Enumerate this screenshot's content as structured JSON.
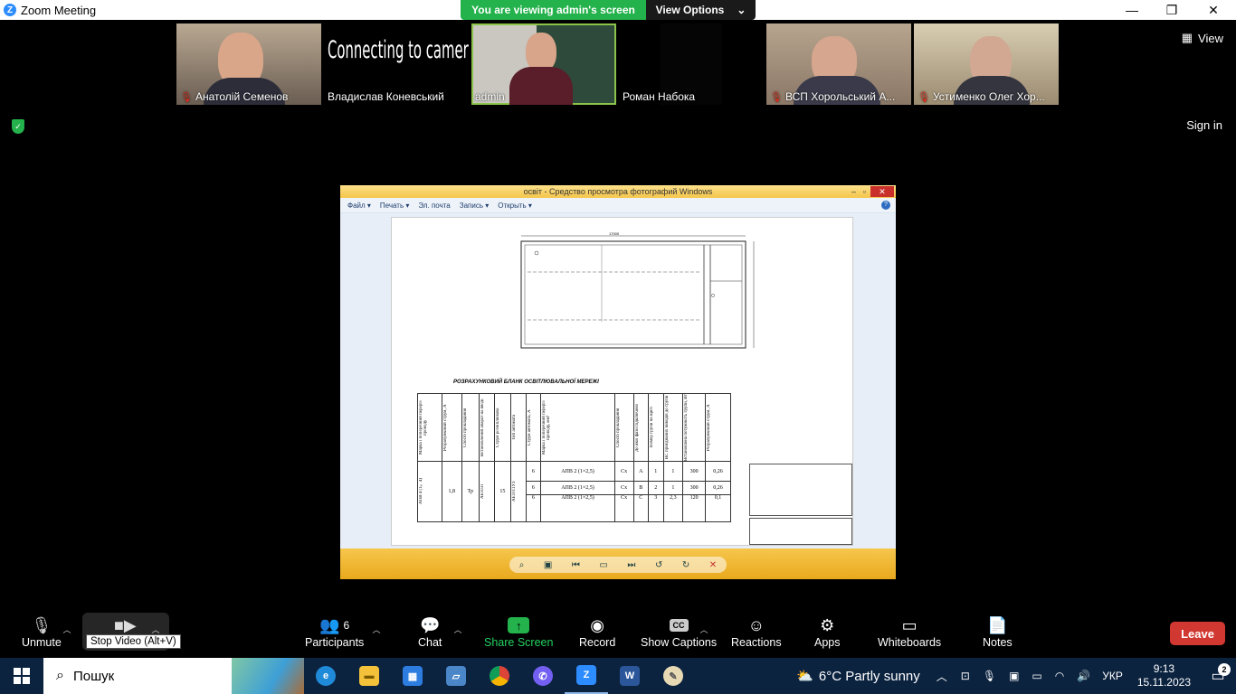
{
  "window": {
    "title": "Zoom Meeting",
    "minimize": "—",
    "restore": "❐",
    "close": "✕"
  },
  "share_banner": {
    "viewing": "You are viewing admin's screen",
    "view_options": "View Options"
  },
  "participants": [
    {
      "name": "Анатолій Семенов",
      "muted": true
    },
    {
      "name": "Владислав Коневський",
      "muted": false,
      "status": "Connecting to camera..."
    },
    {
      "name": "admin",
      "muted": false,
      "active": true
    },
    {
      "name": "Роман Набока",
      "muted": false
    },
    {
      "name": "ВСП Хорольський А...",
      "muted": true
    },
    {
      "name": "Устименко Олег Хор...",
      "muted": true
    }
  ],
  "view_button": "View",
  "sign_in": "Sign in",
  "viewer": {
    "title": "освіт - Средство просмотра фотографий Windows",
    "menu": [
      "Файл ▾",
      "Печать ▾",
      "Эл. почта",
      "Запись ▾",
      "Открыть ▾"
    ],
    "drawing_caption": "РОЗРАХУНКОВИЙ БЛАНК ОСВІТЛЮВАЛЬНОЇ МЕРЕЖІ",
    "drawing_dimension": "17000",
    "table_headers": [
      "Марка і поперечний переріз проводу",
      "Розрахунковий струм, А",
      "Спосіб прокладання",
      "Встановлений апарат на вводі",
      "Струм розчіплювача",
      "Тип автомата",
      "Струм автомата, А",
      "Марка і поперечний переріз проводу, мм²",
      "Спосіб прокладання",
      "До якої фази підключено",
      "Номер групи на щиті",
      "Вс. приєднаних виводів до групи",
      "Встановлена потужність групи, Вт",
      "Розрахунковий струм, А"
    ],
    "table_common": [
      "АПВ 4 (1×4)",
      "1,8",
      "Тр",
      "АЕ1031",
      "15",
      "АЕ1011УЗ"
    ],
    "table_rows": [
      [
        "6",
        "АПВ 2 (1×2,5)",
        "Сх",
        "А",
        "1",
        "1",
        "300",
        "0,26"
      ],
      [
        "6",
        "АПВ 2 (1×2,5)",
        "Сх",
        "В",
        "2",
        "1",
        "300",
        "0,26"
      ],
      [
        "6",
        "АПВ 2 (1×2,5)",
        "Сх",
        "С",
        "3",
        "2,3",
        "120",
        "0,1"
      ]
    ]
  },
  "toolbar": {
    "unmute": "Unmute",
    "stop_video_tooltip": "Stop Video (Alt+V)",
    "participants": "Participants",
    "participants_count": "6",
    "chat": "Chat",
    "share_screen": "Share Screen",
    "record": "Record",
    "show_captions": "Show Captions",
    "reactions": "Reactions",
    "apps": "Apps",
    "whiteboards": "Whiteboards",
    "notes": "Notes",
    "leave": "Leave"
  },
  "taskbar": {
    "search": "Пошук",
    "weather": "6°C  Partly sunny",
    "language": "УКР",
    "time": "9:13",
    "date": "15.11.2023",
    "notifications": "2"
  },
  "colors": {
    "zoom_green": "#23b24b",
    "leave_red": "#d13832",
    "taskbar": "#0c2340"
  }
}
